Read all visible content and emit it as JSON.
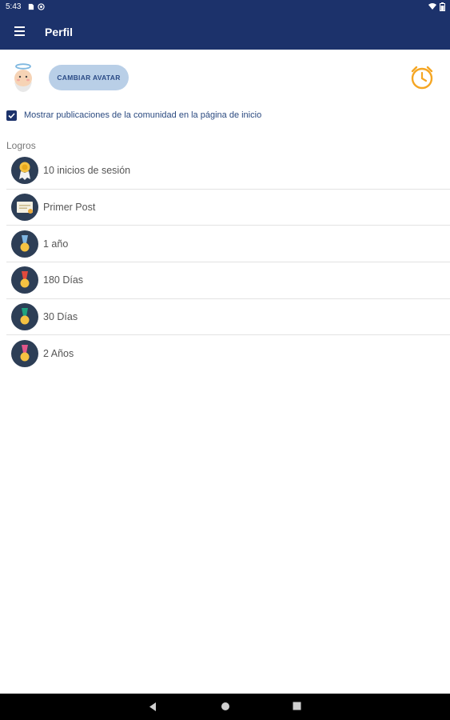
{
  "status_bar": {
    "time": "5:43",
    "left_icons": [
      "sd-card-icon",
      "at-sign-icon"
    ],
    "right_icons": [
      "wifi-icon",
      "battery-icon"
    ]
  },
  "toolbar": {
    "title": "Perfil",
    "menu_icon": "hamburger-menu-icon"
  },
  "profile": {
    "avatar_icon": "angel-avatar-icon",
    "change_avatar_label": "CAMBIAR AVATAR",
    "alarm_icon": "alarm-clock-icon"
  },
  "settings": {
    "show_community_posts_label": "Mostrar publicaciones de la comunidad en la página de inicio",
    "show_community_posts_checked": true
  },
  "achievements": {
    "title": "Logros",
    "items": [
      {
        "label": "10 inicios de sesión",
        "icon": "award-ribbon-icon"
      },
      {
        "label": "Primer Post",
        "icon": "certificate-icon"
      },
      {
        "label": "1 año",
        "icon": "blue-medal-icon"
      },
      {
        "label": "180 Días",
        "icon": "red-medal-icon"
      },
      {
        "label": "30 Días",
        "icon": "green-medal-icon"
      },
      {
        "label": "2 Años",
        "icon": "pink-medal-icon"
      }
    ]
  },
  "colors": {
    "primary": "#1c326b",
    "button_bg": "#b9cfe7",
    "alarm": "#f5a623",
    "badge_bg": "#2d3e56"
  },
  "nav_bar": {
    "icons": [
      "back-icon",
      "home-icon",
      "recents-icon"
    ]
  }
}
